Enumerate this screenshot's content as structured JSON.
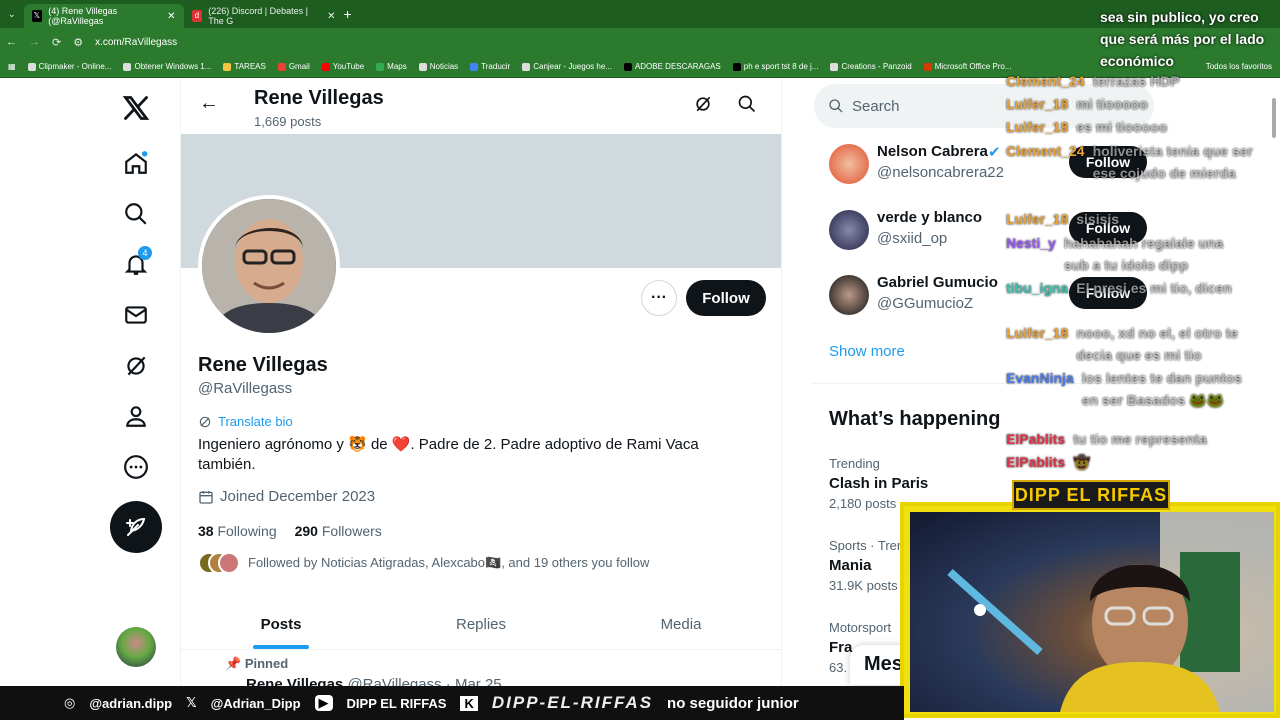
{
  "browser": {
    "tabs": [
      {
        "label": "(4) Rene Villegas (@RaVillegas",
        "active": true
      },
      {
        "label": "(226) Discord | Debates | The G",
        "active": false
      }
    ],
    "url": "x.com/RaVillegass",
    "bookmarks": [
      "Clipmaker - Online...",
      "Obtener Windows 1...",
      "TAREAS",
      "Gmail",
      "YouTube",
      "Maps",
      "Noticias",
      "Traducir",
      "Canjear - Juegos he...",
      "ADOBE DESCARAGAS",
      "ph e sport tst 8 de j...",
      "Creations - Panzoid",
      "Microsoft Office Pro...",
      "Todos los favoritos"
    ]
  },
  "nav": {
    "notifications_badge": "4"
  },
  "header": {
    "title": "Rene Villegas",
    "posts": "1,669 posts"
  },
  "profile": {
    "name": "Rene Villegas",
    "handle": "@RaVillegass",
    "follow_label": "Follow",
    "translate": "Translate bio",
    "bio": "Ingeniero agrónomo y 🐯 de ❤️. Padre de 2.  Padre adoptivo de Rami Vaca también.",
    "joined": "Joined December 2023",
    "following_count": "38",
    "following_label": "Following",
    "followers_count": "290",
    "followers_label": "Followers",
    "followed_by": "Followed by Noticias Atigradas, Alexcabo🏴‍☠️, and 19 others you follow"
  },
  "tabs": [
    "Posts",
    "Replies",
    "Media"
  ],
  "pinned": {
    "label": "Pinned",
    "name": "Rene Villegas",
    "meta": "@RaVillegass · Mar 25"
  },
  "sidebar": {
    "search_placeholder": "Search",
    "suggestions": [
      {
        "name": "Nelson Cabrera",
        "handle": "@nelsoncabrera22",
        "follow": "Follow"
      },
      {
        "name": "verde y blanco",
        "handle": "@sxiid_op",
        "follow": "Follow"
      },
      {
        "name": "Gabriel Gumucio",
        "handle": "@GGumucioZ",
        "follow": "Follow"
      }
    ],
    "show_more": "Show more",
    "whats_happening": "What’s happening",
    "trends": [
      {
        "meta": "Trending",
        "title": "Clash in Paris",
        "count": "2,180 posts"
      },
      {
        "meta": "Sports · Tren",
        "title": "Mania",
        "count": "31.9K posts"
      },
      {
        "meta": "Motorsport",
        "title": "Fra",
        "count": "63."
      }
    ],
    "messages": "Mes"
  },
  "overlay": {
    "chat_top": "sea sin publico, yo creo que será más por el lado económico",
    "chat": [
      {
        "user": "Clement_24",
        "msg": "terrazas HDP",
        "color": "#e8a33a"
      },
      {
        "user": "Luifer_18",
        "msg": "mi tiooooo",
        "color": "#e8a33a"
      },
      {
        "user": "Luifer_18",
        "msg": "es mi tiooooo",
        "color": "#e8a33a"
      },
      {
        "user": "Clement_24",
        "msg": "holiverista tenia que ser ese cojudo de mierda",
        "color": "#e8a33a"
      },
      {
        "user": "Luifer_18",
        "msg": "sisisis",
        "color": "#e8a33a"
      },
      {
        "user": "Nesti_y",
        "msg": "hahahahah regalale una sub a tu idolo dipp",
        "color": "#9b59f5"
      },
      {
        "user": "tibu_igna",
        "msg": "El presi es mi tio, dicen",
        "color": "#3fc0b0"
      },
      {
        "user": "Luifer_18",
        "msg": "nooo, xd no el, el otro te decia que es mi tio",
        "color": "#e8a33a"
      },
      {
        "user": "EvanNinja",
        "msg": "los lentes te dan puntos en ser Basados 🐸🐸",
        "color": "#4a7cf0"
      },
      {
        "user": "ElPablits",
        "msg": "tu tio me representa",
        "color": "#e0344a"
      },
      {
        "user": "ElPablits",
        "msg": "🤠",
        "color": "#e0344a"
      }
    ],
    "streamer_logo": "DIPP EL RIFFAS",
    "ticker": [
      "@adrian.dipp",
      "@Adrian_Dipp",
      "DIPP EL RIFFAS",
      "DIPP-EL-RIFFAS",
      "no seguidor junior"
    ]
  }
}
